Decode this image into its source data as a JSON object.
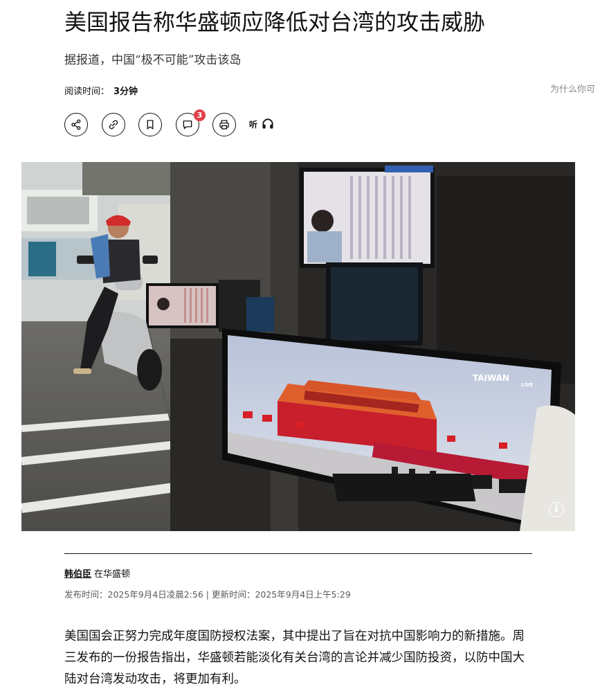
{
  "article": {
    "headline": "美国报告称华盛顿应降低对台湾的攻击威胁",
    "subheadline": "据报道，中国“极不可能”攻击该岛",
    "read_time_label": "阅读时间：",
    "read_time_value": "3分钟",
    "side_promo": "为什么你可",
    "toolbar": {
      "comment_count": "3",
      "listen_label": "听",
      "icons": [
        "share-icon",
        "link-icon",
        "bookmark-icon",
        "comment-icon",
        "print-icon",
        "headphones-icon"
      ]
    },
    "image": {
      "info_label": "i",
      "tv_channel_label": "TAIWAN",
      "tv_live_label": "LIVE"
    },
    "byline": {
      "author": "韩伯臣",
      "location": "在华盛顿"
    },
    "dateline": "发布时间：2025年9月4日凌晨2:56 | 更新时间：2025年9月4日上午5:29",
    "body": "美国国会正努力完成年度国防授权法案，其中提出了旨在对抗中国影响力的新措施。周三发布的一份报告指出，华盛顿若能淡化有关台湾的言论并减少国防投资，以防中国大陆对台湾发动攻击，将更加有利。"
  },
  "colors": {
    "text": "#121212",
    "muted": "#5a5a5a",
    "badge": "#e0404a",
    "tv_red": "#c81f2c",
    "tv_sky": "#cfd6e6"
  }
}
